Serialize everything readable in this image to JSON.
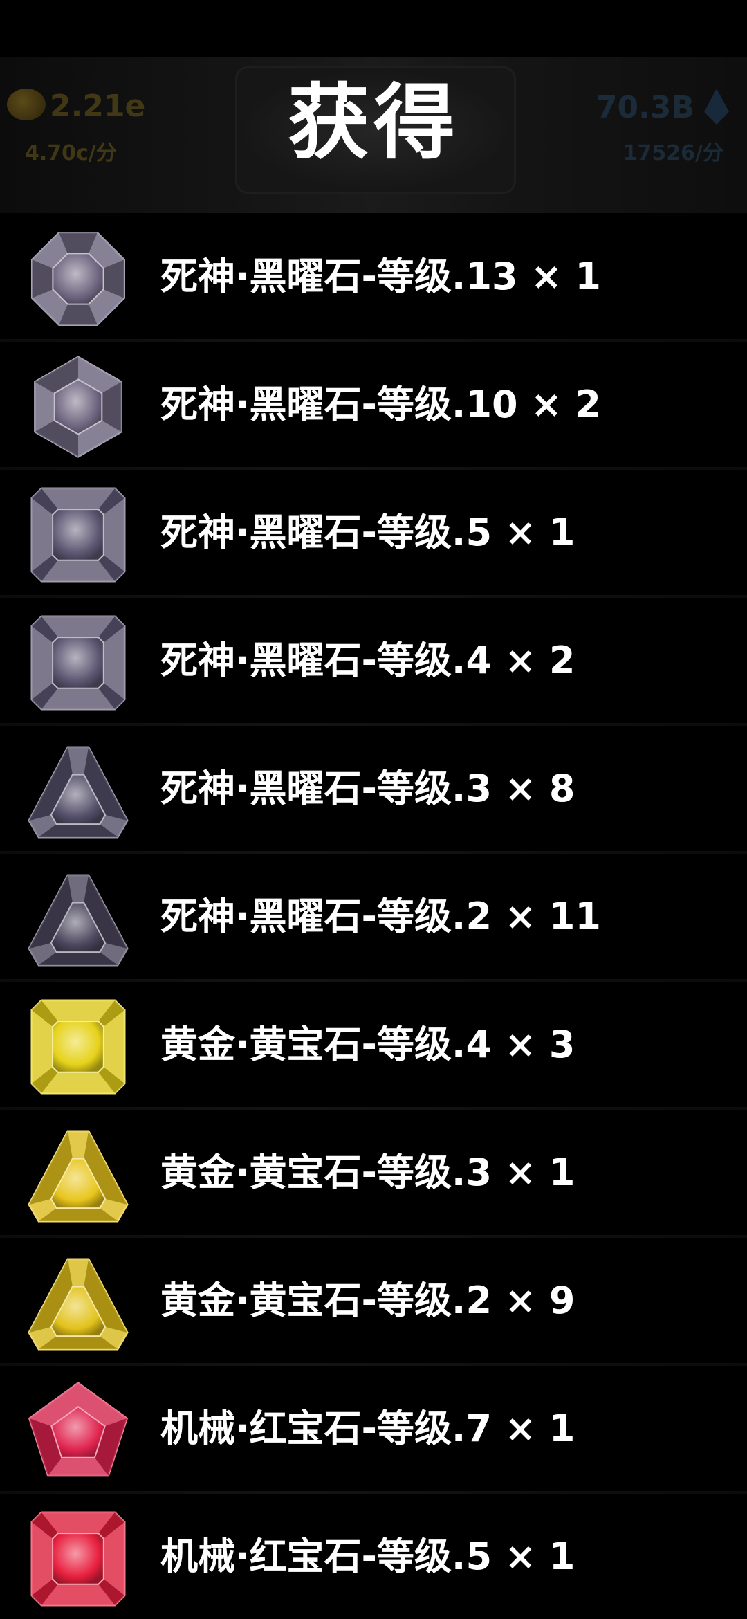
{
  "hud": {
    "gold_value": "2.21e",
    "gold_rate": "4.70c/分",
    "gem_value": "70.3B",
    "gem_rate": "17526/分"
  },
  "title": "获得",
  "rewards": [
    {
      "label": "死神·黑曜石-等级.13 × 1",
      "icon": "obsidian-octagon-gem-icon",
      "color": "#6e6680"
    },
    {
      "label": "死神·黑曜石-等级.10 × 2",
      "icon": "obsidian-hexagon-gem-icon",
      "color": "#6e6680"
    },
    {
      "label": "死神·黑曜石-等级.5 × 1",
      "icon": "obsidian-square-gem-icon",
      "color": "#5f5874"
    },
    {
      "label": "死神·黑曜石-等级.4 × 2",
      "icon": "obsidian-square-gem-icon",
      "color": "#5f5874"
    },
    {
      "label": "死神·黑曜石-等级.3 × 8",
      "icon": "obsidian-triangle-gem-icon",
      "color": "#55506a"
    },
    {
      "label": "死神·黑曜石-等级.2 × 11",
      "icon": "obsidian-triangle-gem-icon",
      "color": "#4d485f"
    },
    {
      "label": "黄金·黄宝石-等级.4 × 3",
      "icon": "topaz-square-gem-icon",
      "color": "#e6d21a"
    },
    {
      "label": "黄金·黄宝石-等级.3 × 1",
      "icon": "topaz-triangle-gem-icon",
      "color": "#e8c51c"
    },
    {
      "label": "黄金·黄宝石-等级.2 × 9",
      "icon": "topaz-triangle-gem-icon",
      "color": "#e2c21a"
    },
    {
      "label": "机械·红宝石-等级.7 × 1",
      "icon": "ruby-pentagon-gem-icon",
      "color": "#e0234e"
    },
    {
      "label": "机械·红宝石-等级.5 × 1",
      "icon": "ruby-square-gem-icon",
      "color": "#e8203f"
    }
  ]
}
